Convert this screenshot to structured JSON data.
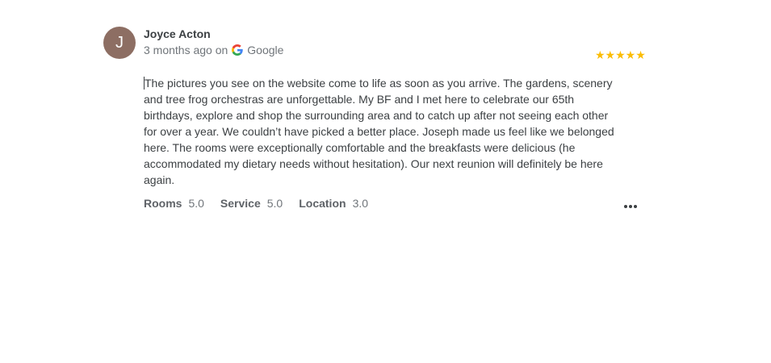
{
  "review": {
    "avatar_letter": "J",
    "author": "Joyce Acton",
    "time_ago": "3 months ago on",
    "source_icon": "google-g-icon",
    "source": "Google",
    "rating_stars": 5,
    "stars_text": "★★★★★",
    "text": "The pictures you see on the website come to life as soon as you arrive. The gardens, scenery and tree frog orchestras are unforgettable. My BF and I met here to celebrate our 65th birthdays, explore and shop the surrounding area and to catch up after not seeing each other for over a year. We couldn’t have picked a better place. Joseph made us feel like we belonged here. The rooms were exceptionally comfortable and the breakfasts were delicious (he accommodated my dietary needs without hesitation). Our next reunion will definitely be here again.",
    "sub_ratings": [
      {
        "label": "Rooms",
        "value": "5.0"
      },
      {
        "label": "Service",
        "value": "5.0"
      },
      {
        "label": "Location",
        "value": "3.0"
      }
    ],
    "more_icon": "more-horiz-icon"
  },
  "colors": {
    "avatar_bg": "#8d6e63",
    "star": "#fbbc04",
    "text": "#3c4043",
    "muted": "#70757a"
  }
}
